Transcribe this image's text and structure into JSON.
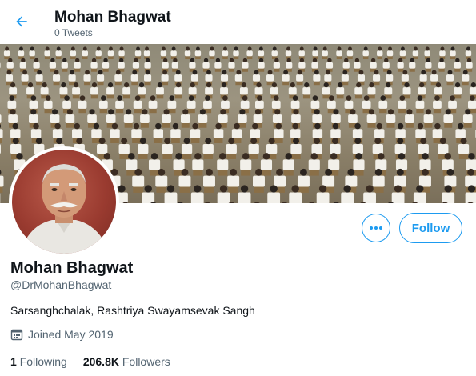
{
  "header": {
    "title": "Mohan Bhagwat",
    "subtitle": "0 Tweets"
  },
  "profile": {
    "name": "Mohan Bhagwat",
    "handle": "@DrMohanBhagwat",
    "bio": "Sarsanghchalak, Rashtriya Swayamsevak Sangh",
    "joined": "Joined May 2019",
    "following_count": "1",
    "following_label": "Following",
    "followers_count": "206.8K",
    "followers_label": "Followers"
  },
  "actions": {
    "follow_label": "Follow",
    "more_label": "•••"
  },
  "icons": {
    "back": "back-arrow-icon",
    "more": "more-options-icon",
    "calendar": "calendar-icon"
  },
  "colors": {
    "accent": "#1d9bf0",
    "text": "#0f1419",
    "muted": "#536471"
  }
}
